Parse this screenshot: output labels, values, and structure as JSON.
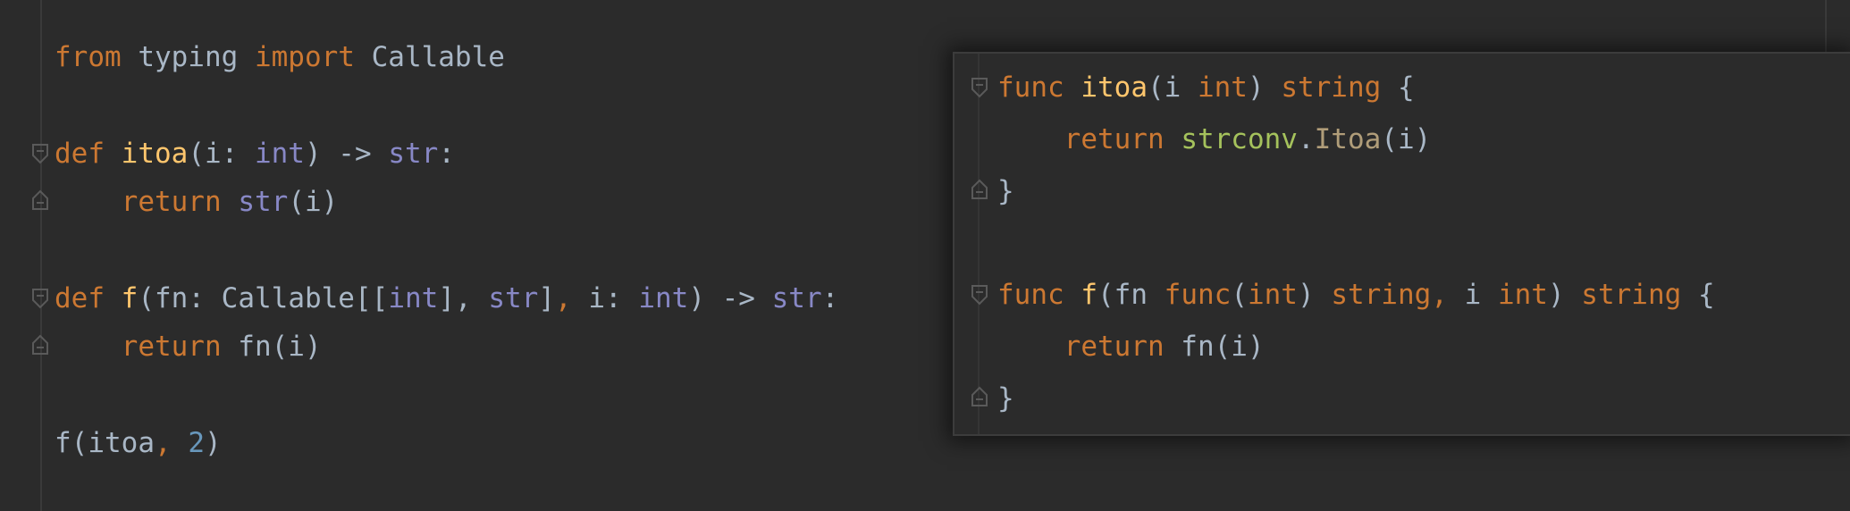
{
  "python": {
    "line1": {
      "kw1": "from",
      "t1": " typing ",
      "kw2": "import",
      "t2": " Callable"
    },
    "line2": {
      "kw": "def",
      "sp": " ",
      "fn": "itoa",
      "p1": "(i: ",
      "bi1": "int",
      "p2": ") -> ",
      "bi2": "str",
      "p3": ":"
    },
    "line3": {
      "indent": "    ",
      "kw": "return",
      "sp": " ",
      "bi": "str",
      "p": "(i)"
    },
    "line4": {
      "kw": "def",
      "sp": " ",
      "fn": "f",
      "p1": "(fn: Callable[[",
      "bi1": "int",
      "p2": "], ",
      "bi2": "str",
      "p3": "]",
      "comma": ",",
      "p4": " i: ",
      "bi3": "int",
      "p5": ") -> ",
      "bi4": "str",
      "p6": ":"
    },
    "line5": {
      "indent": "    ",
      "kw": "return",
      "p": " fn(i)"
    },
    "line6": {
      "p1": "f(itoa",
      "comma": ",",
      "sp": " ",
      "num": "2",
      "p2": ")"
    }
  },
  "go": {
    "line1": {
      "kw": "func",
      "sp": " ",
      "fn": "itoa",
      "p1": "(i ",
      "kw2": "int",
      "p2": ") ",
      "kw3": "string",
      "p3": " {"
    },
    "line2": {
      "indent": "    ",
      "kw": "return",
      "sp": " ",
      "pkg": "strconv",
      "dot": ".",
      "gofn": "Itoa",
      "p": "(i)"
    },
    "line3": {
      "p": "}"
    },
    "line4": {
      "kw": "func",
      "sp": " ",
      "fn": "f",
      "p1": "(fn ",
      "kw2": "func",
      "p2": "(",
      "kw3": "int",
      "p3": ") ",
      "kw4": "string",
      "comma": ",",
      "p4": " i ",
      "kw5": "int",
      "p5": ") ",
      "kw6": "string",
      "p6": " {"
    },
    "line5": {
      "indent": "    ",
      "kw": "return",
      "p": " fn(i)"
    },
    "line6": {
      "p": "}"
    }
  },
  "colors": {
    "background": "#2b2b2b",
    "keyword": "#cc7832",
    "function": "#ffc66d",
    "builtin": "#8888c6",
    "number": "#6897bb",
    "package": "#a5c25c",
    "default": "#a9b7c6"
  },
  "icons": {
    "fold_start": "fold-start-icon",
    "fold_end": "fold-end-icon"
  }
}
